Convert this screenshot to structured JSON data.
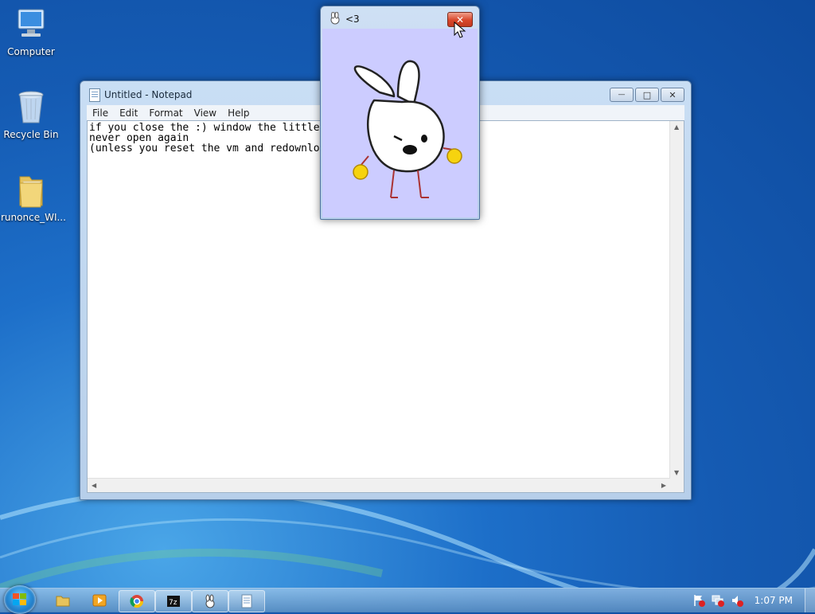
{
  "desktop": {
    "icons": [
      {
        "label": "Computer",
        "icon": "computer-icon"
      },
      {
        "label": "Recycle Bin",
        "icon": "recycle-bin-icon"
      },
      {
        "label": "runonce_WI...",
        "icon": "folder-icon"
      }
    ]
  },
  "notepad": {
    "title": "Untitled - Notepad",
    "menu": [
      "File",
      "Edit",
      "Format",
      "View",
      "Help"
    ],
    "content": "if you close the :) window the little\nnever open again\n(unless you reset the vm and redownlo",
    "caption_buttons": {
      "minimize": "—",
      "maximize": "□",
      "close": "✕"
    }
  },
  "heart_window": {
    "title": "<3",
    "close": "✕"
  },
  "taskbar": {
    "items": [
      "start-button",
      "explorer",
      "media-player",
      "chrome",
      "7zip",
      "bunny-app",
      "notepad"
    ],
    "clock": "1:07 PM"
  },
  "colors": {
    "desktop": "#1d6fc9",
    "heart_client_bg": "#ccccff",
    "close_red": "#d8472b"
  }
}
